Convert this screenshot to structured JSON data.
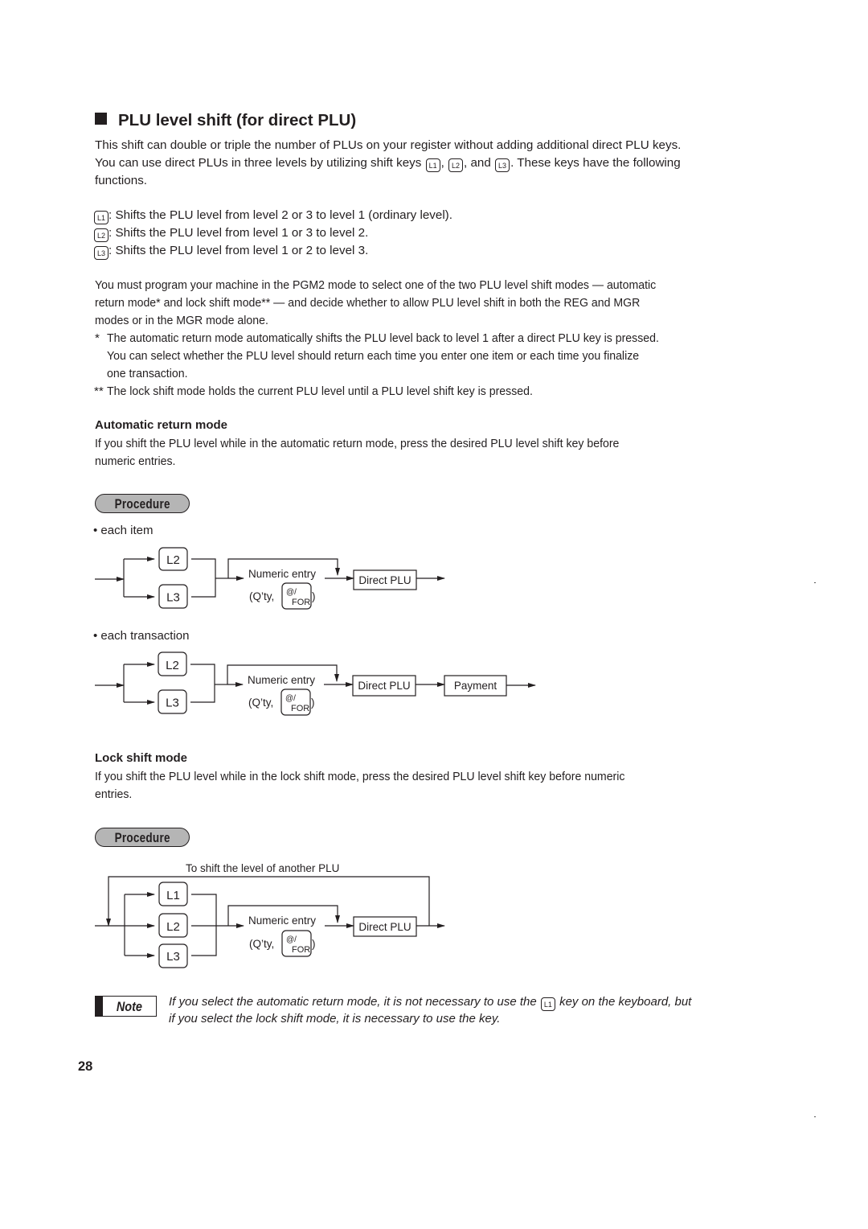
{
  "section": {
    "title": "PLU level shift (for direct PLU)",
    "intro": {
      "line1": "This shift can double or triple the number of PLUs on your register without adding additional direct PLU keys.",
      "line2_pre": "You can use direct PLUs in three levels by utilizing shift keys",
      "line2_sep1": ",",
      "line2_sep2": ", and",
      "line2_post": ". These keys have the following",
      "line3": "functions."
    },
    "keys": {
      "l1": "L1",
      "l2": "L2",
      "l3": "L3"
    },
    "key_functions": [
      {
        "key": "L1",
        "text": ": Shifts the PLU level from level 2 or 3 to level 1 (ordinary level)."
      },
      {
        "key": "L2",
        "text": ": Shifts the PLU level from level 1 or 3 to level 2."
      },
      {
        "key": "L3",
        "text": ": Shifts the PLU level from level 1 or 2 to level 3."
      }
    ],
    "mode_paragraph": [
      "You must program your machine in the PGM2 mode to select one of the two PLU level shift modes — automatic",
      "return mode* and lock shift mode** — and decide whether to allow PLU level shift in both the REG and MGR",
      "modes or in the MGR mode alone."
    ],
    "footnotes": [
      {
        "mark": "*",
        "lines": [
          "The automatic return mode automatically shifts the PLU level back to level 1 after a direct PLU key is pressed.",
          "You can select whether the PLU level should return each time you enter one item or each time you finalize",
          "one transaction."
        ]
      },
      {
        "mark": "**",
        "lines": [
          "The lock shift mode holds the current PLU level until a PLU level shift key is pressed."
        ]
      }
    ]
  },
  "automatic": {
    "heading": "Automatic return mode",
    "lines": [
      "If you shift the PLU level while in the automatic return mode, press the desired PLU level shift key before",
      "numeric entries."
    ],
    "procedure_label": "Procedure",
    "each_item": {
      "label": "• each item",
      "keys": [
        "L2",
        "L3"
      ],
      "numeric_entry": "Numeric entry",
      "qty_prefix": "(Q’ty,",
      "qty_suffix": ")",
      "for_key_top": "@/",
      "for_key_bottom": "FOR",
      "direct_plu": "Direct PLU"
    },
    "each_transaction": {
      "label": "• each transaction",
      "keys": [
        "L2",
        "L3"
      ],
      "numeric_entry": "Numeric entry",
      "qty_prefix": "(Q’ty,",
      "qty_suffix": ")",
      "for_key_top": "@/",
      "for_key_bottom": "FOR",
      "direct_plu": "Direct PLU",
      "payment": "Payment"
    }
  },
  "lock": {
    "heading": "Lock shift mode",
    "lines": [
      "If you shift the PLU level while in the lock shift mode, press the desired PLU level shift key before numeric",
      "entries."
    ],
    "procedure_label": "Procedure",
    "diagram": {
      "loop_label": "To shift the level of another PLU",
      "keys": [
        "L1",
        "L2",
        "L3"
      ],
      "numeric_entry": "Numeric entry",
      "qty_prefix": "(Q’ty,",
      "qty_suffix": ")",
      "for_key_top": "@/",
      "for_key_bottom": "FOR",
      "direct_plu": "Direct PLU"
    }
  },
  "note": {
    "label": "Note",
    "line1_pre": "If you select the automatic return mode, it is not necessary to use the",
    "line1_key": "L1",
    "line1_post": "key on the keyboard, but",
    "line2": "if you select the lock shift mode, it is necessary to use the key."
  },
  "page_number": "28"
}
